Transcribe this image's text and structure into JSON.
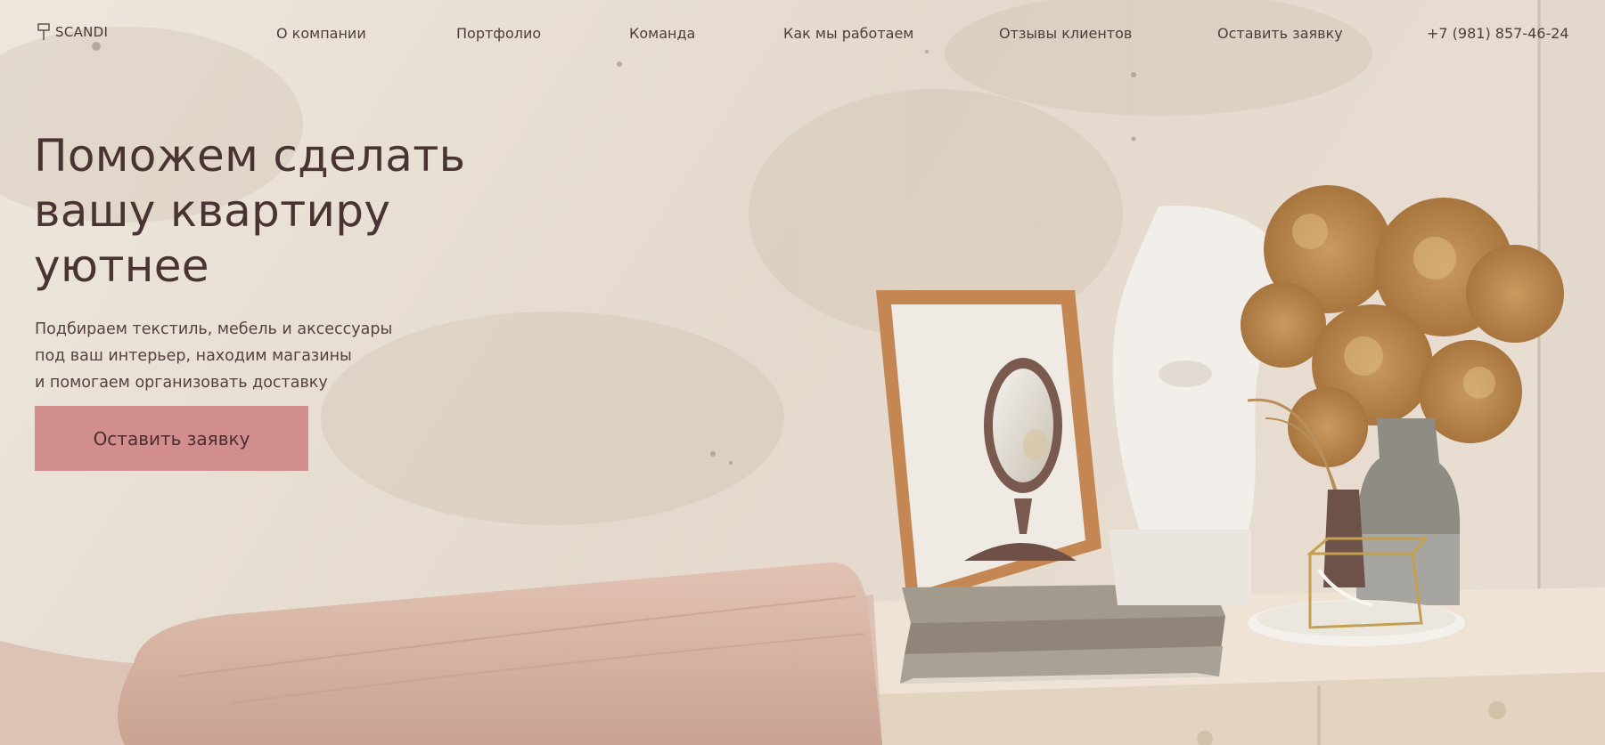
{
  "header": {
    "logo_text": "SCANDI",
    "logo_icon": "lamp-icon",
    "nav": [
      {
        "label": "О компании"
      },
      {
        "label": "Портфолио"
      },
      {
        "label": "Команда"
      },
      {
        "label": "Как мы работаем"
      },
      {
        "label": "Отзывы клиентов"
      },
      {
        "label": "Оставить заявку"
      }
    ],
    "phone": "+7 (981) 857-46-24"
  },
  "hero": {
    "title_lines": [
      "Поможем сделать",
      "вашу квартиру",
      "уютнее"
    ],
    "subtitle_lines": [
      "Подбираем текстиль, мебель и аксессуары",
      "под ваш интерьер, находим магазины",
      "и помогаем организовать доставку"
    ],
    "cta_label": "Оставить заявку"
  },
  "colors": {
    "accent_button": "#d28e8c",
    "text_dark": "#4a3433",
    "wall": "#e9e1d6"
  }
}
